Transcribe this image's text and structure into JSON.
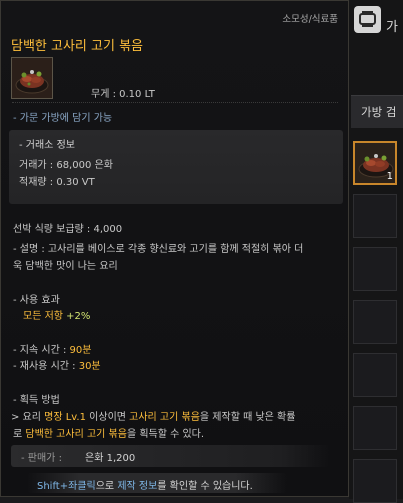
{
  "tooltip": {
    "category": "소모성/식료품",
    "title": "담백한 고사리 고기 볶음",
    "icon": "meat-dish-icon",
    "weight": "무게 :  0.10 LT",
    "bag_note": "- 가문 가방에 담기 가능",
    "trade": {
      "header": "- 거래소 정보",
      "price": "거래가 : 68,000 은화",
      "load": "적재량 : 0.30 VT"
    },
    "supply": "선박 식량 보급량 : 4,000",
    "description_line1": "- 설명 : 고사리를 베이스로 각종 향신료와 고기를 함께 적절히 볶아 더",
    "description_line2": "욱 담백한 맛이 나는 요리",
    "effect": {
      "header": "- 사용 효과",
      "label": "모든 저항",
      "value": "+2%"
    },
    "duration": {
      "label": "- 지속 시간 : ",
      "value": "90분"
    },
    "cooldown": {
      "label": "- 재사용 시간 : ",
      "value": "30분"
    },
    "acquire": {
      "header": "- 획득 방법",
      "l1_a": " > 요리 ",
      "l1_b": "명장 Lv.1",
      "l1_c": " 이상이면 ",
      "l1_d": "고사리 고기 볶음",
      "l1_e": "을 제작할 때 낮은 확률",
      "l2_a": "로 ",
      "l2_b": "담백한 고사리 고기 볶음",
      "l2_c": "을 획득할 수 있다."
    },
    "sell": {
      "label": "- 판매가 : ",
      "value": "은화 1,200"
    },
    "hint": {
      "key": "Shift+좌클릭",
      "mid": "으로 ",
      "target": "제작 정보",
      "end": "를 확인할 수 있습니다."
    }
  },
  "inventory": {
    "bag_icon": "bag-icon",
    "title": "가",
    "tab_label": "가방 검",
    "slots": [
      {
        "qty": "1",
        "icon": "meat-dish-icon"
      },
      {},
      {},
      {},
      {},
      {},
      {}
    ]
  }
}
